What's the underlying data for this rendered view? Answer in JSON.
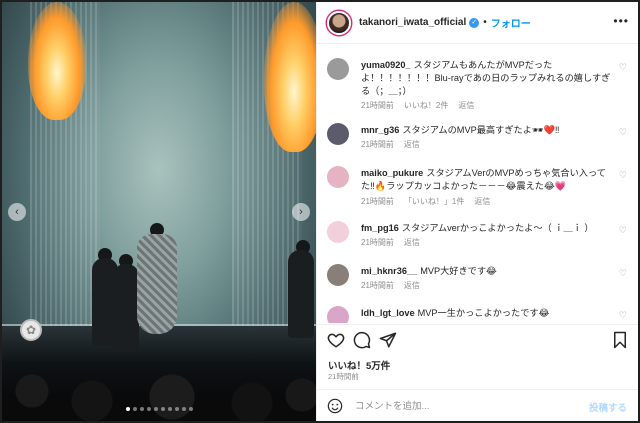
{
  "post": {
    "username": "takanori_iwata_official",
    "separator": "•",
    "follow_label": "フォロー",
    "more_label": "•••"
  },
  "media": {
    "prev_arrow": "‹",
    "next_arrow": "›",
    "slide_count": 10,
    "active_slide": 1
  },
  "comments": [
    {
      "username": "yuma0920_",
      "text": "スタジアムもあんたがMVPだったよ！！！！！！！Blu-rayであの日のラップみれるの嬉しすぎる（；＿；）",
      "time": "21時間前",
      "likes": "いいね！2件",
      "reply": "返信",
      "avatar_color": "#9a9a9a"
    },
    {
      "username": "mnr_g36",
      "text": "スタジアムのMVP最高すぎたよ🕶❤️‼",
      "time": "21時間前",
      "likes": "",
      "reply": "返信",
      "avatar_color": "#5b5b6b"
    },
    {
      "username": "maiko_pukure",
      "text": "スタジアムVerのMVPめっちゃ気合い入ってた‼🔥ラップカッコよかった－－－😂震えた😂💗",
      "time": "21時間前",
      "likes": "「いいね！」1件",
      "reply": "返信",
      "avatar_color": "#e6b3c2"
    },
    {
      "username": "fm_pg16",
      "text": "スタジアムverかっこよかったよ〜（ ｉ＿ｉ ）",
      "time": "21時間前",
      "likes": "",
      "reply": "返信",
      "avatar_color": "#f1d0dc"
    },
    {
      "username": "mi_hknr36__",
      "text": "MVP大好きです😂",
      "time": "21時間前",
      "likes": "",
      "reply": "返信",
      "avatar_color": "#8a7f78"
    },
    {
      "username": "ldh_lgt_love",
      "text": "MVP一生かっこよかったです😂",
      "time": "",
      "likes": "",
      "reply": "",
      "avatar_color": "#d9a6c9"
    }
  ],
  "actions": {
    "like_count": "いいね！5万件",
    "timestamp": "21時間前"
  },
  "add_comment": {
    "placeholder": "コメントを追加...",
    "post_label": "投稿する"
  },
  "colors": {
    "accent": "#0095f6",
    "verified": "#3897f0",
    "muted": "#8e8e8e",
    "post_disabled": "#b3dbff",
    "story_ring": "#d62976"
  },
  "icons": [
    "heart-icon",
    "comment-icon",
    "share-icon",
    "bookmark-icon",
    "emoji-icon",
    "verified-icon",
    "more-icon"
  ]
}
